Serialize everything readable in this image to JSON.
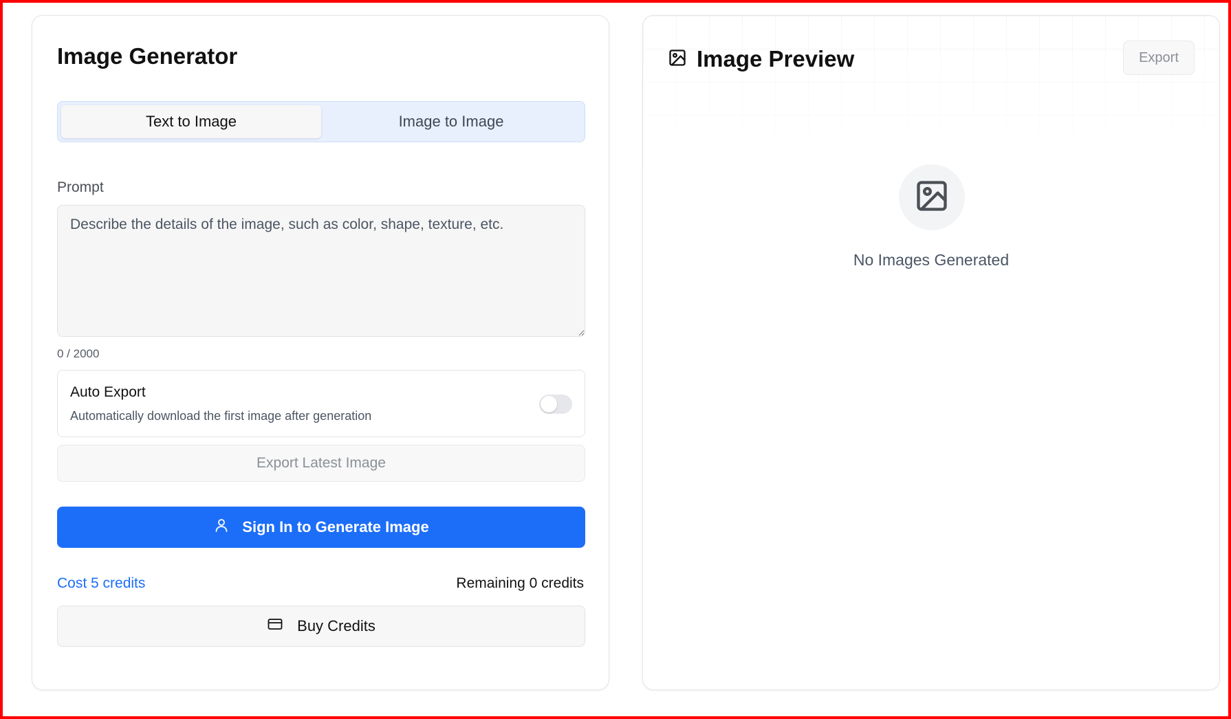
{
  "generator": {
    "title": "Image Generator",
    "tabs": [
      {
        "label": "Text to Image",
        "active": true
      },
      {
        "label": "Image to Image",
        "active": false
      }
    ],
    "prompt": {
      "label": "Prompt",
      "value": "",
      "placeholder": "Describe the details of the image, such as color, shape, texture, etc.",
      "counter": "0 / 2000"
    },
    "auto_export": {
      "title": "Auto Export",
      "description": "Automatically download the first image after generation",
      "enabled": false
    },
    "export_latest_label": "Export Latest Image",
    "sign_in_label": "Sign In to Generate Image",
    "cost_label": "Cost 5 credits",
    "remaining_label": "Remaining 0 credits",
    "buy_credits_label": "Buy Credits"
  },
  "preview": {
    "title": "Image Preview",
    "export_label": "Export",
    "empty_message": "No Images Generated"
  },
  "colors": {
    "accent": "#1c6ef8",
    "frame_border": "#ff0000",
    "tab_bg": "#e8f0fe"
  },
  "icons": {
    "preview_header": "image-icon",
    "empty_state": "image-icon",
    "sign_in": "user-icon",
    "buy_credits": "credit-card-icon"
  }
}
